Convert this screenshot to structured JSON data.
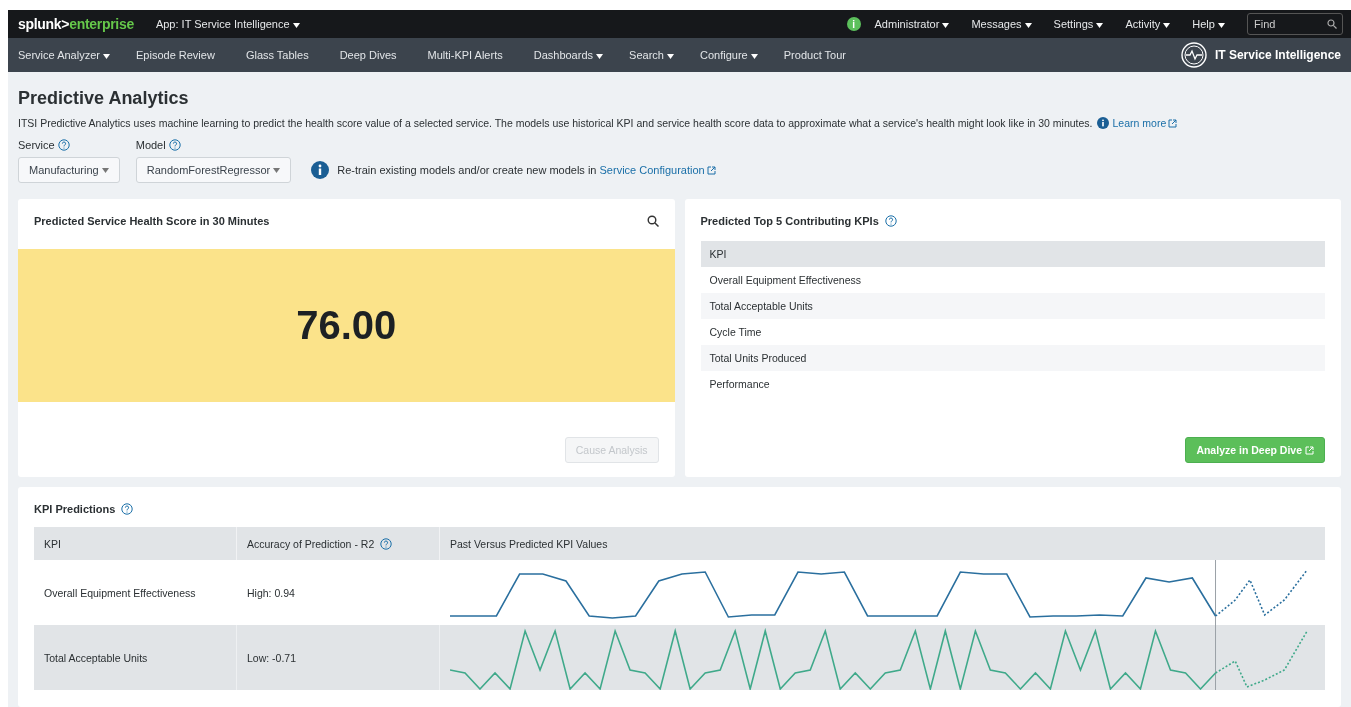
{
  "top_bar": {
    "logo": {
      "brand": "splunk>",
      "product": "enterprise"
    },
    "app_menu": {
      "label": "App: IT Service Intelligence",
      "dropdown": true
    },
    "status_icon": "i",
    "menus": [
      {
        "label": "Administrator",
        "dropdown": true
      },
      {
        "label": "Messages",
        "dropdown": true
      },
      {
        "label": "Settings",
        "dropdown": true
      },
      {
        "label": "Activity",
        "dropdown": true
      },
      {
        "label": "Help",
        "dropdown": true
      }
    ],
    "search": {
      "placeholder": "Find"
    }
  },
  "nav": {
    "items": [
      {
        "label": "Service Analyzer",
        "dropdown": true
      },
      {
        "label": "Episode Review",
        "dropdown": false
      },
      {
        "label": "Glass Tables",
        "dropdown": false
      },
      {
        "label": "Deep Dives",
        "dropdown": false
      },
      {
        "label": "Multi-KPI Alerts",
        "dropdown": false
      },
      {
        "label": "Dashboards",
        "dropdown": true
      },
      {
        "label": "Search",
        "dropdown": true
      },
      {
        "label": "Configure",
        "dropdown": true
      },
      {
        "label": "Product Tour",
        "dropdown": false
      }
    ],
    "app_title": "IT Service Intelligence"
  },
  "page": {
    "title": "Predictive Analytics",
    "description": "ITSI Predictive Analytics uses machine learning to predict the health score value of a selected service. The models use historical KPI and service health score data to approximate what a service's health might look like in 30 minutes.",
    "learn_more": "Learn more",
    "filters": [
      {
        "label": "Service",
        "value": "Manufacturing"
      },
      {
        "label": "Model",
        "value": "RandomForestRegressor"
      }
    ],
    "info": {
      "text": "Re-train existing models and/or create new models in",
      "link": "Service Configuration"
    }
  },
  "score_panel": {
    "title": "Predicted Service Health Score in 30 Minutes",
    "score": "76.00",
    "button": {
      "label": "Cause Analysis",
      "disabled": true
    }
  },
  "kpi_panel": {
    "title": "Predicted Top 5 Contributing KPIs",
    "column": "KPI",
    "rows": [
      "Overall Equipment Effectiveness",
      "Total Acceptable Units",
      "Cycle Time",
      "Total Units Produced",
      "Performance"
    ],
    "button": {
      "label": "Analyze in Deep Dive",
      "disabled": false
    }
  },
  "predictions": {
    "title": "KPI Predictions",
    "columns": [
      "KPI",
      "Accuracy of Prediction - R2",
      "Past Versus Predicted KPI Values"
    ],
    "rows": [
      {
        "kpi": "Overall Equipment Effectiveness",
        "accuracy": "High: 0.94",
        "kind": "step",
        "color": "#2a6f9e"
      },
      {
        "kpi": "Total Acceptable Units",
        "accuracy": "Low: -0.71",
        "kind": "spike",
        "color": "#3fa98a"
      }
    ]
  }
}
